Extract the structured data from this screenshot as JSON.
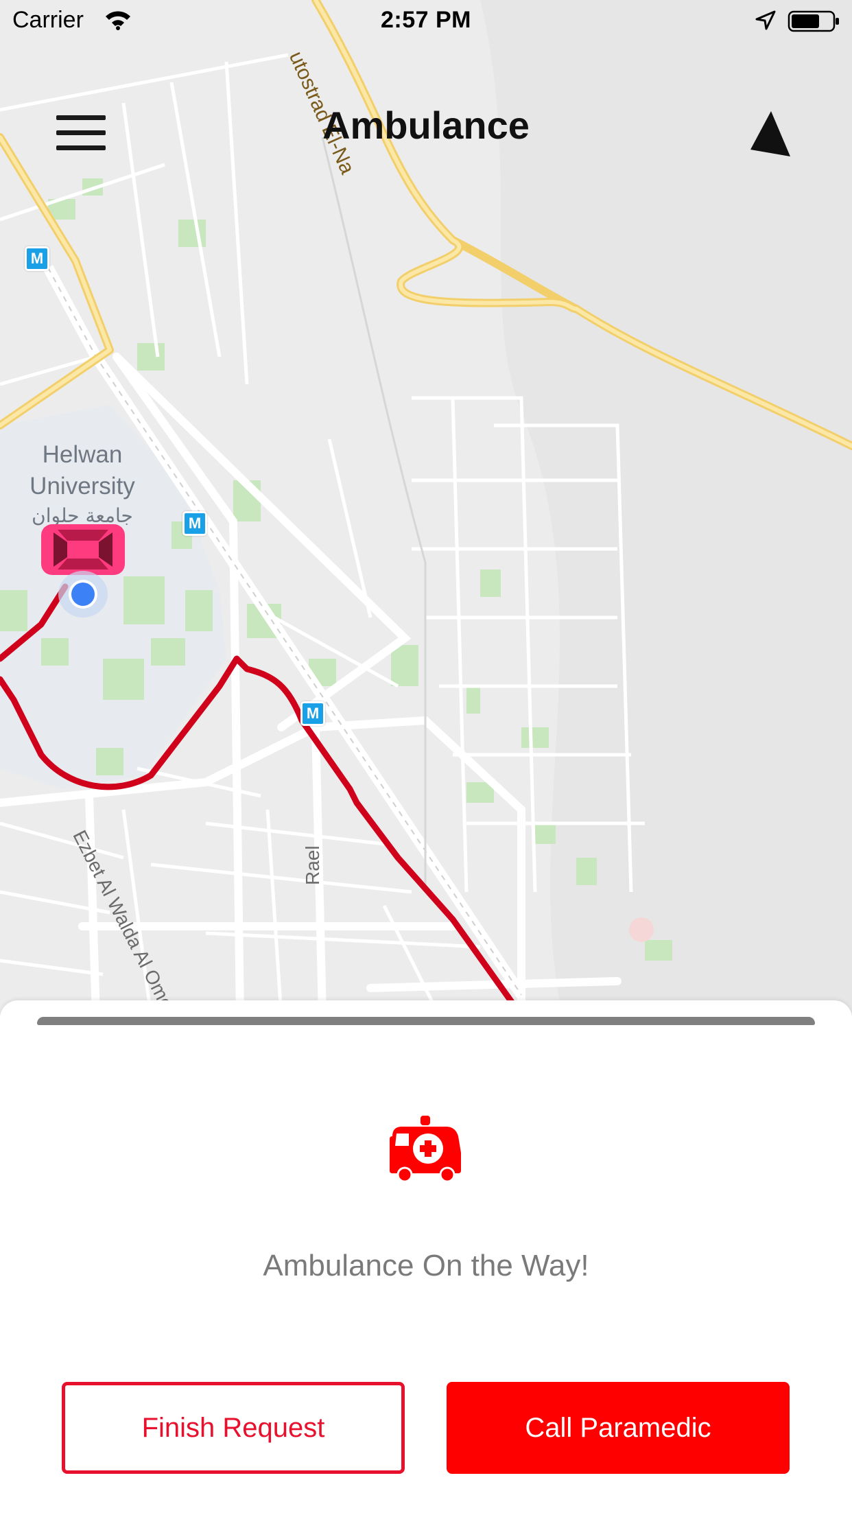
{
  "status_bar": {
    "carrier": "Carrier",
    "time": "2:57 PM"
  },
  "nav": {
    "title": "Ambulance",
    "menu_icon": "hamburger-menu-icon",
    "navigate_icon": "navigation-arrow-icon"
  },
  "map": {
    "poi": {
      "name_en_line1": "Helwan",
      "name_en_line2": "University",
      "name_ar": "جامعة حلوان"
    },
    "streets": {
      "autostrad": "utostrad El-Na",
      "ezbet": "Ezbet Al Walda Al Omomi",
      "rael": "Rael"
    },
    "metro_label": "M",
    "route_color": "#d0021b",
    "vehicle_color": "#ff3b7f"
  },
  "sheet": {
    "status_message": "Ambulance On the Way!",
    "icon": "ambulance-icon",
    "finish_label": "Finish Request",
    "call_label": "Call Paramedic",
    "accent_color": "#ff0000"
  }
}
